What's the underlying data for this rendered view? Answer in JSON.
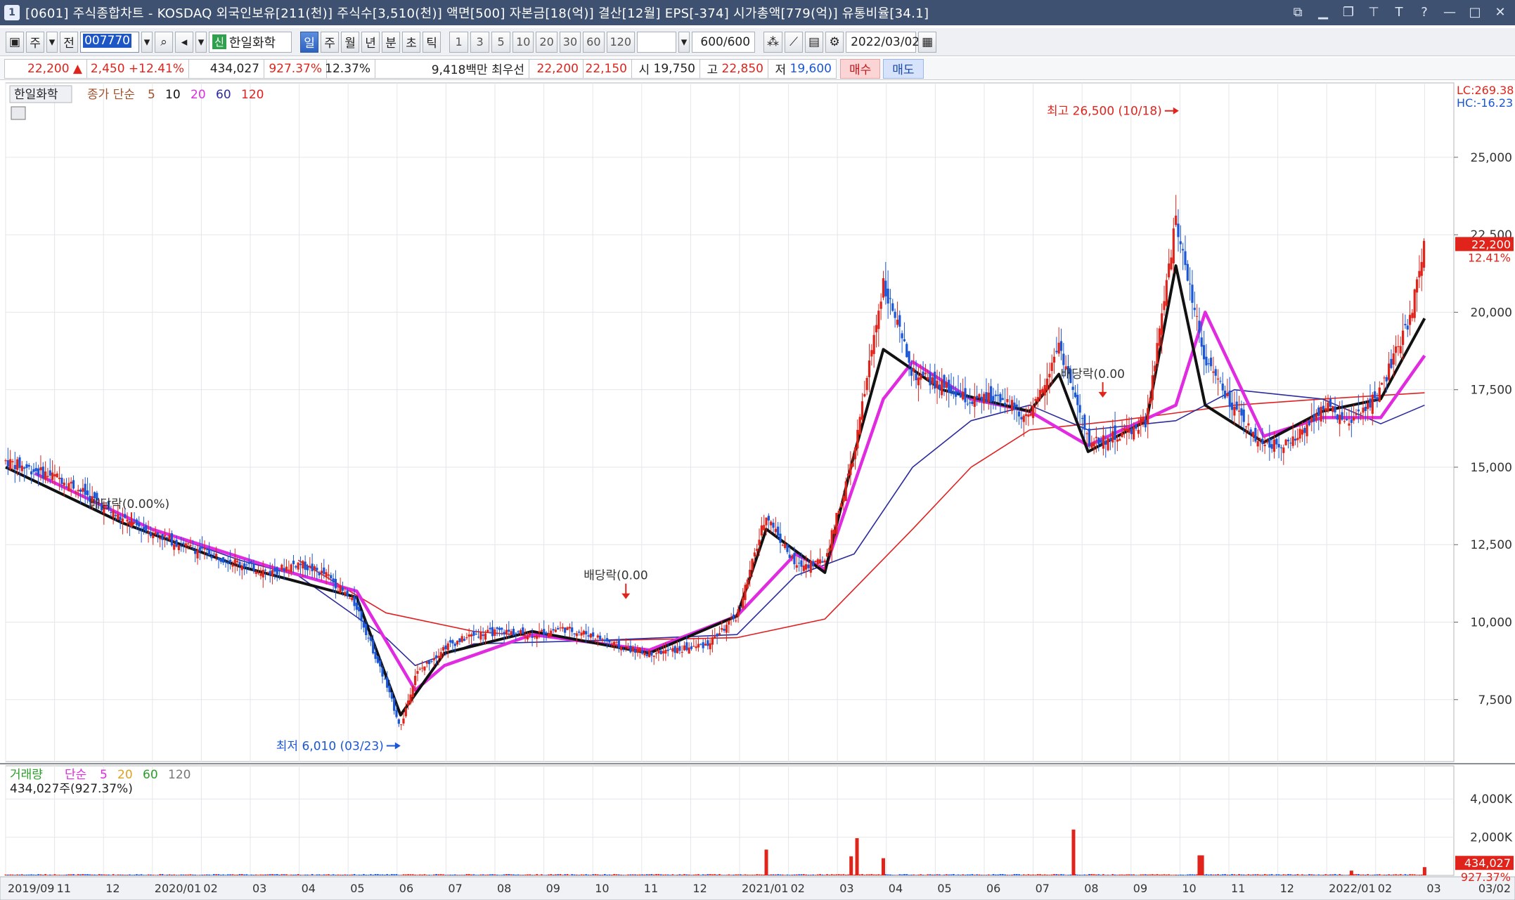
{
  "window": {
    "icon_label": "1",
    "title": "[0601] 주식종합차트 - KOSDAQ 외국인보유[211(천)] 주식수[3,510(천)] 액면[500] 자본금[18(억)] 결산[12월] EPS[-374] 시가총액[779(억)] 유통비율[34.1]"
  },
  "toolbar": {
    "mode_label": "주",
    "prev_label": "전",
    "code": "007770",
    "new_tag": "신",
    "stock_name": "한일화학",
    "periods": [
      "일",
      "주",
      "월",
      "년",
      "분",
      "초",
      "틱"
    ],
    "active_period": "일",
    "intervals": [
      "1",
      "3",
      "5",
      "10",
      "20",
      "30",
      "60",
      "120"
    ],
    "count": "600/600",
    "date": "2022/03/02"
  },
  "quote": {
    "price": "22,200",
    "change": "2,450",
    "change_pct": "+12.41%",
    "volume": "434,027",
    "volume_ratio": "927.37%",
    "turnover": "12.37%",
    "amount": "9,418백만",
    "best_ask_label": "최우선",
    "best_ask": "22,200",
    "best_bid": "22,150",
    "open_label": "시",
    "open": "19,750",
    "high_label": "고",
    "high": "22,850",
    "low_label": "저",
    "low": "19,600",
    "buy_label": "매수",
    "sell_label": "매도"
  },
  "price_panel": {
    "stock_label": "한일화학",
    "ma_title": "종가 단순",
    "ma_periods": [
      "5",
      "10",
      "20",
      "60",
      "120"
    ],
    "lc_label": "LC:269.38",
    "hc_label": "HC:-16.23",
    "last_price_badge": "22,200",
    "last_pct_badge": "12.41%",
    "high_note": "최고 26,500 (10/18)",
    "low_note": "최저 6,010 (03/23)",
    "dividend_notes": [
      "배당락(0.00%)",
      "배당락(0.00",
      "배당락(0.00"
    ]
  },
  "volume_panel": {
    "title": "거래량",
    "ma_title": "단순",
    "ma_periods": [
      "5",
      "20",
      "60",
      "120"
    ],
    "current_label": "434,027주(927.37%)",
    "last_badge": "434,027",
    "last_pct_badge": "927.37%"
  },
  "colors": {
    "ma5": "#111111",
    "ma10": "#e02be0",
    "ma20": "#e02be0",
    "ma60": "#2b2b9e",
    "ma120": "#e02020",
    "up": "#e0241b",
    "down": "#1a56d6",
    "accent": "#3f5170"
  },
  "chart_data": {
    "type": "candlestick",
    "y_axis_ticks": [
      "25,000",
      "22,500",
      "20,000",
      "17,500",
      "15,000",
      "12,500",
      "10,000",
      "7,500"
    ],
    "ylim": [
      5500,
      27400
    ],
    "volume_axis_ticks": [
      "4,000K",
      "2,000K"
    ],
    "volume_ylim": [
      0,
      5000
    ],
    "x_axis_ticks": [
      "2019/09",
      "11",
      "12",
      "2020/01",
      "02",
      "03",
      "04",
      "05",
      "06",
      "07",
      "08",
      "09",
      "10",
      "11",
      "12",
      "2021/01",
      "02",
      "03",
      "04",
      "05",
      "06",
      "07",
      "08",
      "09",
      "10",
      "11",
      "12",
      "2022/01",
      "02",
      "03"
    ],
    "x_axis_right_label": "03/02",
    "close_series": [
      {
        "t": 0,
        "v": 15200
      },
      {
        "t": 2,
        "v": 14600
      },
      {
        "t": 4,
        "v": 13300
      },
      {
        "t": 6,
        "v": 12500
      },
      {
        "t": 8,
        "v": 11900
      },
      {
        "t": 9,
        "v": 11600
      },
      {
        "t": 10,
        "v": 11900
      },
      {
        "t": 11,
        "v": 11500
      },
      {
        "t": 12,
        "v": 10500
      },
      {
        "t": 13,
        "v": 8000
      },
      {
        "t": 13.5,
        "v": 6600
      },
      {
        "t": 14,
        "v": 8300
      },
      {
        "t": 15,
        "v": 9200
      },
      {
        "t": 16,
        "v": 9600
      },
      {
        "t": 17,
        "v": 9700
      },
      {
        "t": 18,
        "v": 9600
      },
      {
        "t": 19,
        "v": 9800
      },
      {
        "t": 20,
        "v": 9600
      },
      {
        "t": 21,
        "v": 9200
      },
      {
        "t": 22,
        "v": 9000
      },
      {
        "t": 23,
        "v": 9100
      },
      {
        "t": 24,
        "v": 9300
      },
      {
        "t": 25,
        "v": 10200
      },
      {
        "t": 26,
        "v": 13500
      },
      {
        "t": 27,
        "v": 11800
      },
      {
        "t": 28,
        "v": 12000
      },
      {
        "t": 29,
        "v": 15400
      },
      {
        "t": 30,
        "v": 21000
      },
      {
        "t": 31,
        "v": 18000
      },
      {
        "t": 32,
        "v": 17600
      },
      {
        "t": 33,
        "v": 17100
      },
      {
        "t": 34,
        "v": 17300
      },
      {
        "t": 35,
        "v": 16500
      },
      {
        "t": 36,
        "v": 19000
      },
      {
        "t": 37,
        "v": 15800
      },
      {
        "t": 38,
        "v": 16000
      },
      {
        "t": 39,
        "v": 16500
      },
      {
        "t": 40,
        "v": 23000
      },
      {
        "t": 41,
        "v": 18500
      },
      {
        "t": 42,
        "v": 16800
      },
      {
        "t": 43,
        "v": 15700
      },
      {
        "t": 44,
        "v": 15800
      },
      {
        "t": 45,
        "v": 17000
      },
      {
        "t": 46,
        "v": 16400
      },
      {
        "t": 47,
        "v": 17500
      },
      {
        "t": 48,
        "v": 19800
      },
      {
        "t": 48.5,
        "v": 22200
      }
    ],
    "ma_series_points": {
      "ma5": [
        [
          0,
          15000
        ],
        [
          4,
          13200
        ],
        [
          8,
          11800
        ],
        [
          12,
          10800
        ],
        [
          13.5,
          7000
        ],
        [
          15,
          9000
        ],
        [
          18,
          9700
        ],
        [
          22,
          9000
        ],
        [
          25,
          10200
        ],
        [
          26,
          13000
        ],
        [
          28,
          11600
        ],
        [
          29,
          15400
        ],
        [
          30,
          18800
        ],
        [
          32,
          17500
        ],
        [
          35,
          16800
        ],
        [
          36,
          18000
        ],
        [
          37,
          15500
        ],
        [
          39,
          16500
        ],
        [
          40,
          21500
        ],
        [
          41,
          17000
        ],
        [
          43,
          15800
        ],
        [
          45,
          16800
        ],
        [
          47,
          17200
        ],
        [
          48.5,
          19800
        ]
      ],
      "ma10": [
        [
          1,
          14800
        ],
        [
          5,
          13000
        ],
        [
          9,
          11800
        ],
        [
          12,
          11000
        ],
        [
          14,
          7800
        ],
        [
          15,
          8600
        ],
        [
          18,
          9600
        ],
        [
          22,
          9100
        ],
        [
          25,
          10200
        ],
        [
          27,
          12200
        ],
        [
          28,
          11700
        ],
        [
          30,
          17200
        ],
        [
          31,
          18400
        ],
        [
          33,
          17200
        ],
        [
          35,
          16800
        ],
        [
          37,
          15700
        ],
        [
          40,
          17000
        ],
        [
          41,
          20000
        ],
        [
          43,
          16000
        ],
        [
          45,
          16600
        ],
        [
          47,
          16600
        ],
        [
          48.5,
          18600
        ]
      ],
      "ma60": [
        [
          5,
          13000
        ],
        [
          8,
          12000
        ],
        [
          10,
          11500
        ],
        [
          13,
          9500
        ],
        [
          14,
          8600
        ],
        [
          16,
          9300
        ],
        [
          20,
          9400
        ],
        [
          25,
          9600
        ],
        [
          27,
          11500
        ],
        [
          29,
          12200
        ],
        [
          31,
          15000
        ],
        [
          33,
          16500
        ],
        [
          35,
          17000
        ],
        [
          37,
          16200
        ],
        [
          40,
          16500
        ],
        [
          42,
          17500
        ],
        [
          45,
          17200
        ],
        [
          47,
          16400
        ],
        [
          48.5,
          17000
        ]
      ],
      "ma120": [
        [
          10,
          12000
        ],
        [
          13,
          10300
        ],
        [
          16,
          9700
        ],
        [
          20,
          9400
        ],
        [
          25,
          9500
        ],
        [
          28,
          10100
        ],
        [
          31,
          13000
        ],
        [
          33,
          15000
        ],
        [
          35,
          16200
        ],
        [
          38,
          16500
        ],
        [
          42,
          17000
        ],
        [
          45,
          17200
        ],
        [
          48.5,
          17400
        ]
      ]
    },
    "volume_spikes": [
      {
        "t": 26,
        "v": 1350
      },
      {
        "t": 28.9,
        "v": 1000
      },
      {
        "t": 29.1,
        "v": 1950
      },
      {
        "t": 30,
        "v": 900
      },
      {
        "t": 36.5,
        "v": 2400
      },
      {
        "t": 40.8,
        "v": 1050
      },
      {
        "t": 40.9,
        "v": 1050
      },
      {
        "t": 46,
        "v": 250
      },
      {
        "t": 48.5,
        "v": 434
      }
    ]
  }
}
